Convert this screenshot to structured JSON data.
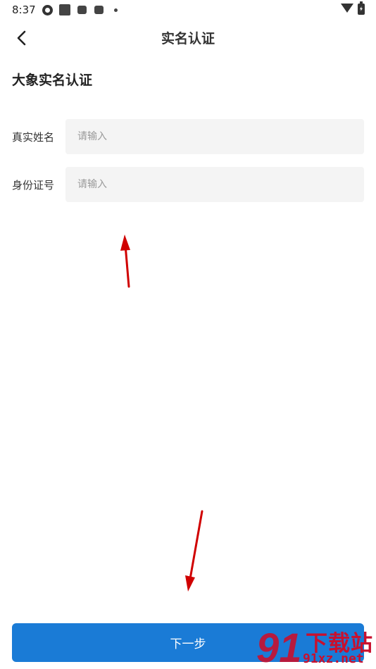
{
  "status_bar": {
    "time": "8:37",
    "icons": [
      "aperture-icon",
      "square-icon",
      "square-icon",
      "square-icon",
      "dot-icon",
      "wifi-icon",
      "battery-charging-icon"
    ]
  },
  "header": {
    "title": "实名认证",
    "back_icon": "chevron-left-icon"
  },
  "page": {
    "heading": "大象实名认证"
  },
  "form": {
    "fields": [
      {
        "label": "真实姓名",
        "placeholder": "请输入",
        "value": ""
      },
      {
        "label": "身份证号",
        "placeholder": "请输入",
        "value": ""
      }
    ]
  },
  "footer": {
    "next_label": "下一步"
  },
  "annotation": {
    "arrow_color": "#d00000"
  },
  "watermark": {
    "logo_text": "91",
    "text_cn": "下载站",
    "text_en": "91xz.net",
    "color": "#c8102e"
  },
  "colors": {
    "primary": "#1a7bd6",
    "input_bg": "#f4f4f4"
  }
}
